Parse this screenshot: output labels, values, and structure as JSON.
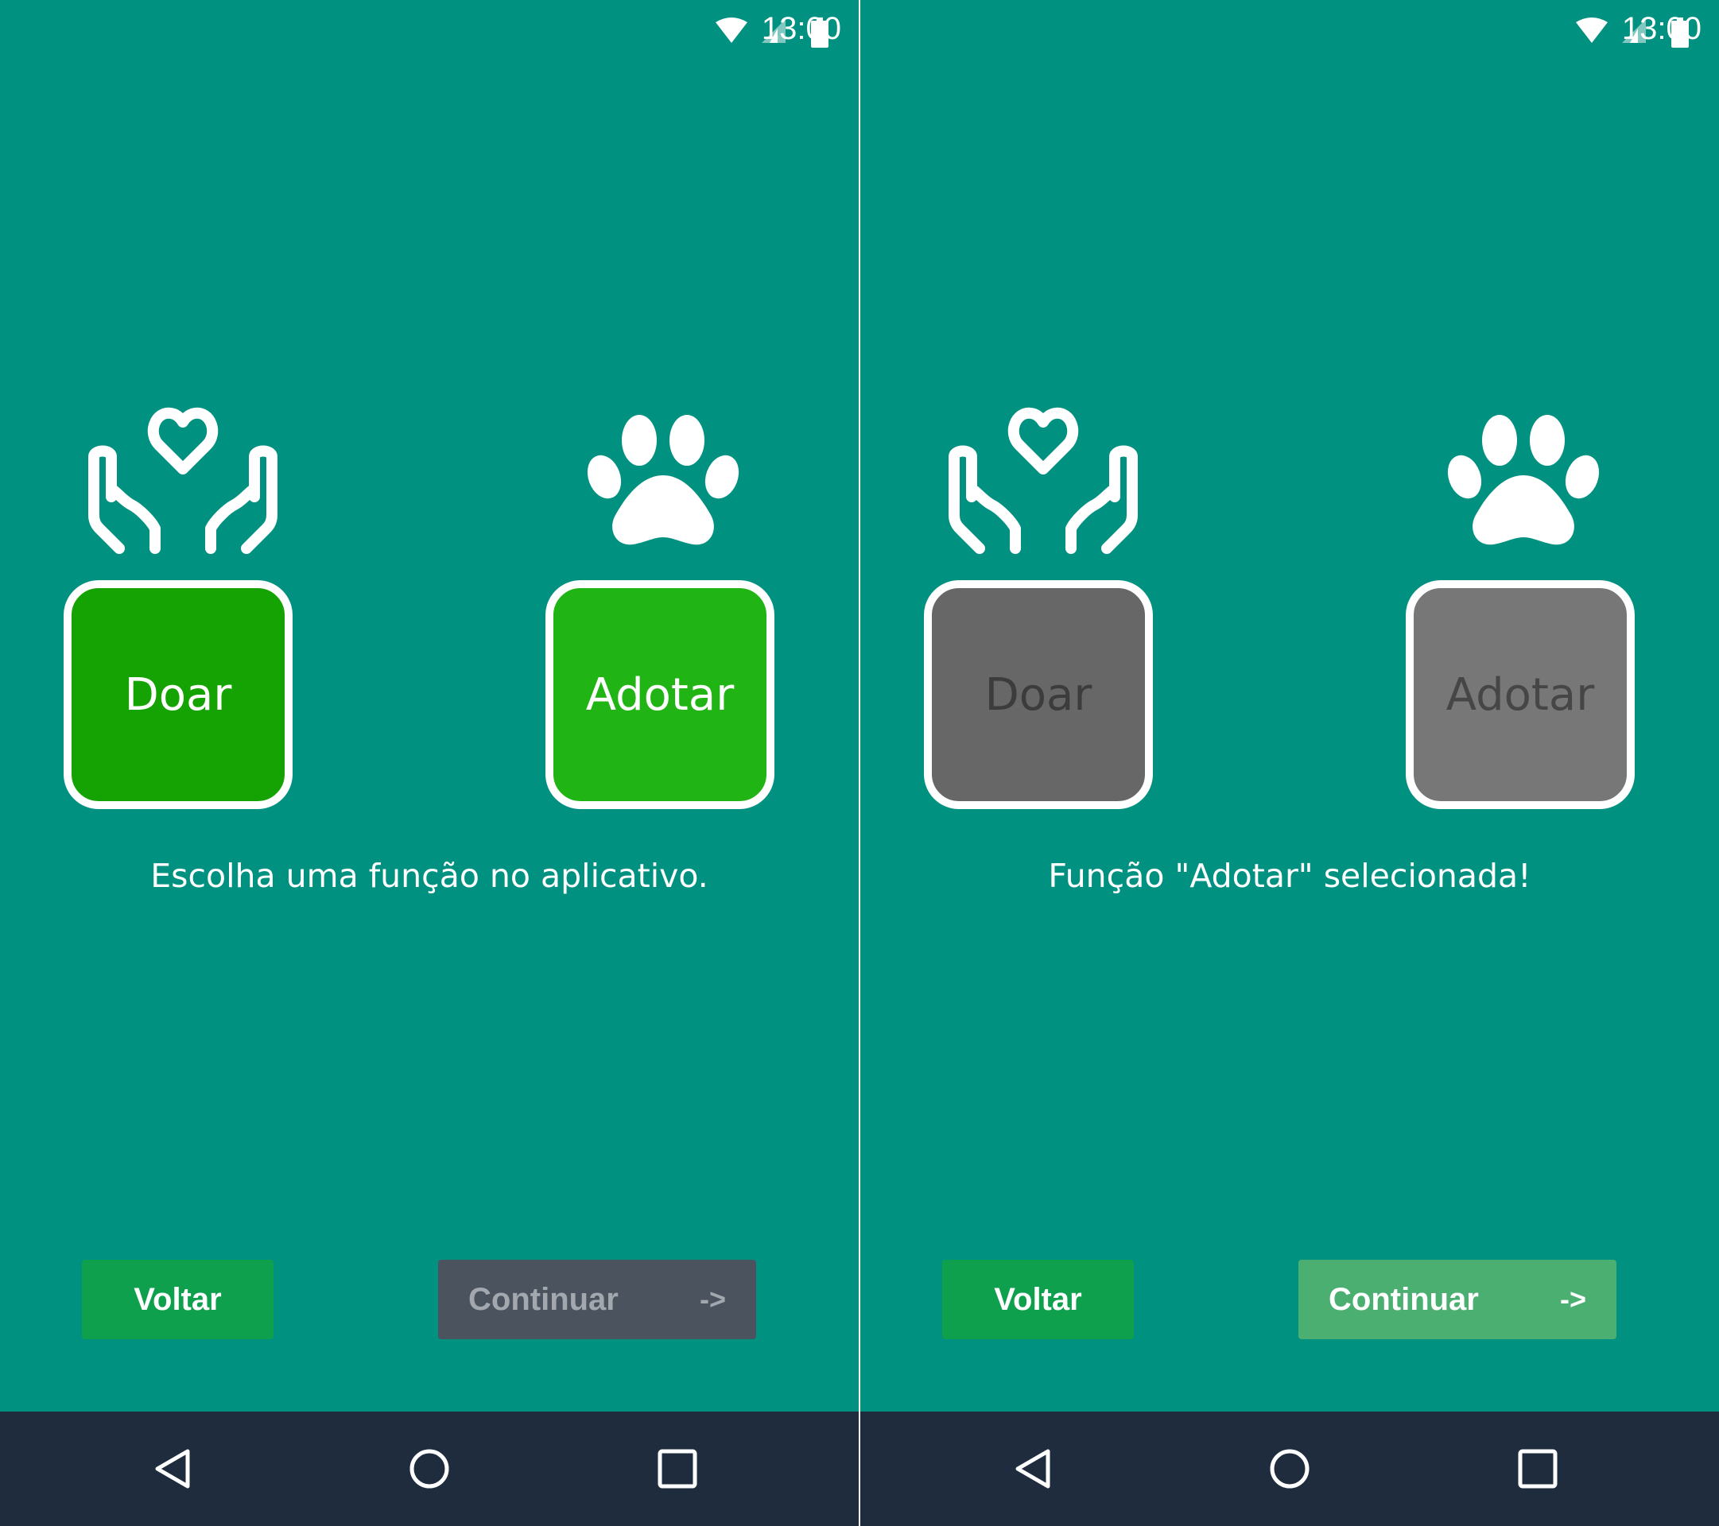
{
  "status_bar": {
    "time": "13:00",
    "icons": [
      "wifi-icon",
      "cell-signal-icon",
      "battery-icon"
    ]
  },
  "colors": {
    "background": "#019181",
    "nav_bar": "#1f2c3e",
    "back_button": "#0ea04c",
    "doar_active": "#14a302",
    "adotar_active": "#20b514",
    "doar_inactive": "#676767",
    "adotar_inactive": "#777777",
    "continue_disabled": "#4a535e",
    "continue_enabled": "#4caf72"
  },
  "screens": [
    {
      "state": "no-selection",
      "cards": {
        "doar": "Doar",
        "adotar": "Adotar"
      },
      "illustrations": [
        "hands-heart-icon",
        "paw-print-icon"
      ],
      "message": "Escolha uma função no aplicativo.",
      "buttons": {
        "back": "Voltar",
        "continue": "Continuar",
        "continue_arrow": "->",
        "continue_enabled": false
      }
    },
    {
      "state": "adotar-selected",
      "cards": {
        "doar": "Doar",
        "adotar": "Adotar"
      },
      "illustrations": [
        "hands-heart-icon",
        "paw-print-icon"
      ],
      "message": "Função \"Adotar\" selecionada!",
      "buttons": {
        "back": "Voltar",
        "continue": "Continuar",
        "continue_arrow": "->",
        "continue_enabled": true
      }
    }
  ],
  "nav_bar": {
    "icons": [
      "back-nav-icon",
      "home-nav-icon",
      "recents-nav-icon"
    ]
  }
}
